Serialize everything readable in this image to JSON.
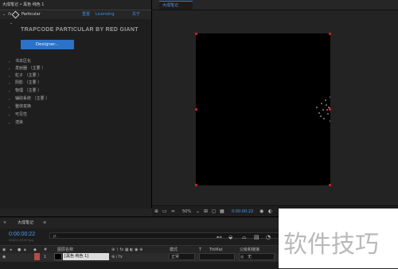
{
  "effect_panel": {
    "header": "大成笔记 • 黑色 纯色 1",
    "effect_name": "Particular",
    "reset": "重置",
    "licensing": "Licensing",
    "about": "关于",
    "brand": "TRAPCODE PARTICULAR BY RED GIANT",
    "designer_button": "Designer...",
    "properties": [
      "书本区化",
      "发射器 （主要 ）",
      "粒子 （主要 ）",
      "阴影 （主要 ）",
      "物理 （主要 ）",
      "辅助系统 （主要 ）",
      "整体变换",
      "可见性",
      "渲染"
    ]
  },
  "viewer": {
    "tab": "大成笔记",
    "zoom": "50%",
    "timecode_small": "0:00:00:22"
  },
  "timeline": {
    "tab": "大成笔记",
    "menu": "≡",
    "timecode": "0:00:00:22",
    "fps": "00022 (25.00 fps)",
    "search_placeholder": "ρ.",
    "columns": {
      "layer_name": "图层名称",
      "mode": "模式",
      "t": "T",
      "trkmat": "TrkMat",
      "parent": "父级和链接"
    },
    "layer": {
      "number": "1",
      "name": "[黑色 纯色 1]",
      "mode": "正常",
      "parent": "无"
    }
  },
  "watermark": "软件技巧"
}
